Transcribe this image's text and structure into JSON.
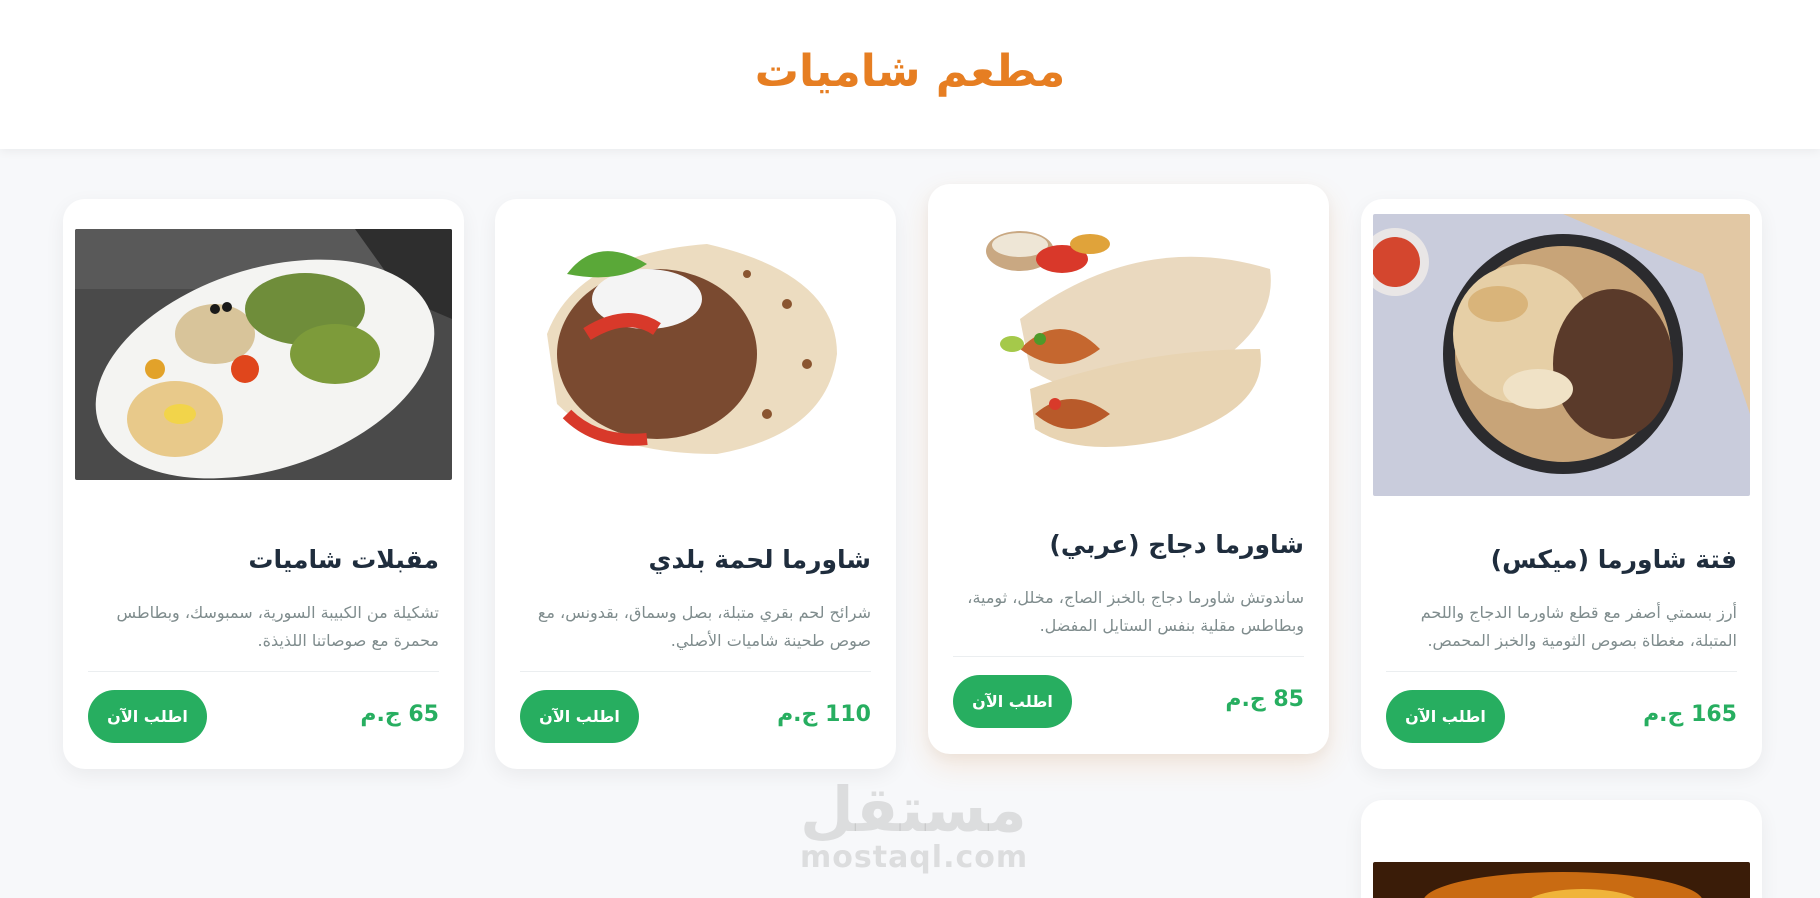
{
  "header": {
    "title": "مطعم شاميات"
  },
  "cards": [
    {
      "title": "فتة شاورما (ميكس)",
      "description": "أرز بسمتي أصفر مع قطع شاورما الدجاج واللحم المتبلة، مغطاة بصوص الثومية والخبز المحمص.",
      "price": "165 ج.م",
      "button": "اطلب الآن",
      "image": "fatteh-shawarma-mix-photo"
    },
    {
      "title": "شاورما دجاج (عربي)",
      "description": "ساندوتش شاورما دجاج بالخبز الصاج، مخلل، ثومية، وبطاطس مقلية بنفس الستايل المفضل.",
      "price": "85 ج.م",
      "button": "اطلب الآن",
      "image": "chicken-shawarma-wrap-photo"
    },
    {
      "title": "شاورما لحمة بلدي",
      "description": "شرائح لحم بقري متبلة، بصل وسماق، بقدونس، مع صوص طحينة شاميات الأصلي.",
      "price": "110 ج.م",
      "button": "اطلب الآن",
      "image": "beef-shawarma-wrap-photo"
    },
    {
      "title": "مقبلات شاميات",
      "description": "تشكيلة من الكبيبة السورية، سمبوسك، وبطاطس محمرة مع صوصاتنا اللذيذة.",
      "price": "65 ج.م",
      "button": "اطلب الآن",
      "image": "appetizers-platter-photo"
    }
  ],
  "watermark": {
    "arabic": "مستقل",
    "latin": "mostaql.com"
  },
  "colors": {
    "accent": "#e67e22",
    "price": "#27ae60",
    "button": "#27ae60",
    "title": "#1f2d3d"
  }
}
